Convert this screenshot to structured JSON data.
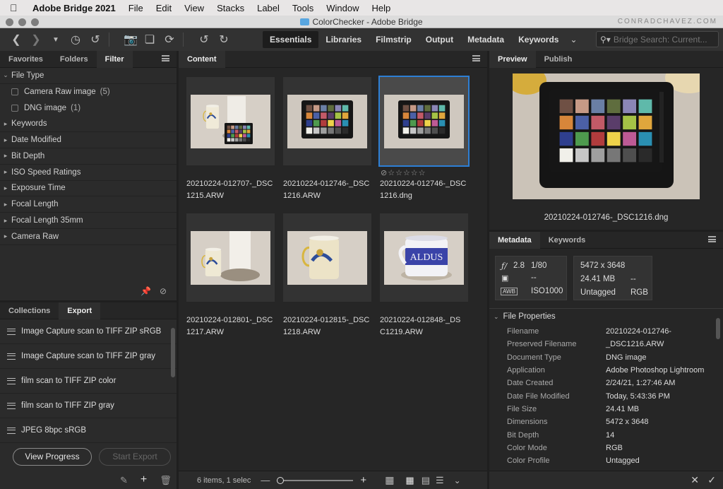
{
  "menubar": {
    "apple": "",
    "app": "Adobe Bridge 2021",
    "items": [
      "File",
      "Edit",
      "View",
      "Stacks",
      "Label",
      "Tools",
      "Window",
      "Help"
    ]
  },
  "window": {
    "title": "ColorChecker - Adobe Bridge",
    "credit": "CONRADCHAVEZ.COM"
  },
  "toolbar": {
    "workspaces": [
      "Essentials",
      "Libraries",
      "Filmstrip",
      "Output",
      "Metadata",
      "Keywords"
    ],
    "active_workspace": "Essentials",
    "search_placeholder": "Bridge Search: Current..."
  },
  "left_panel": {
    "tabs": [
      "Favorites",
      "Folders",
      "Filter"
    ],
    "active_tab": "Filter",
    "file_type_label": "File Type",
    "file_types": [
      {
        "label": "Camera Raw image",
        "count": "(5)"
      },
      {
        "label": "DNG image",
        "count": "(1)"
      }
    ],
    "filters": [
      "Keywords",
      "Date Modified",
      "Bit Depth",
      "ISO Speed Ratings",
      "Exposure Time",
      "Focal Length",
      "Focal Length 35mm",
      "Camera Raw"
    ]
  },
  "export_panel": {
    "tabs": [
      "Collections",
      "Export"
    ],
    "active_tab": "Export",
    "presets": [
      "Image Capture scan to TIFF ZIP sRGB",
      "Image Capture scan to TIFF ZIP gray",
      "film scan to TIFF ZIP color",
      "film scan to TIFF ZIP gray",
      "JPEG 8bpc sRGB"
    ],
    "view_progress": "View Progress",
    "start_export": "Start Export"
  },
  "content": {
    "tab": "Content",
    "items": [
      {
        "name": "20210224-012707-_DSC1215.ARW",
        "line1": "20210224-012707-_DSC",
        "line2": "1215.ARW",
        "kind": "mug-checker",
        "selected": false
      },
      {
        "name": "20210224-012746-_DSC1216.ARW",
        "line1": "20210224-012746-_DSC",
        "line2": "1216.ARW",
        "kind": "checker",
        "selected": false
      },
      {
        "name": "20210224-012746-_DSC1216.dng",
        "line1": "20210224-012746-_DSC",
        "line2": "1216.dng",
        "kind": "checker",
        "selected": true
      },
      {
        "name": "20210224-012801-_DSC1217.ARW",
        "line1": "20210224-012801-_DSC",
        "line2": "1217.ARW",
        "kind": "mug-roll",
        "selected": false
      },
      {
        "name": "20210224-012815-_DSC1218.ARW",
        "line1": "20210224-012815-_DSC",
        "line2": "1218.ARW",
        "kind": "mug",
        "selected": false
      },
      {
        "name": "20210224-012848-_DSC1219.ARW",
        "line1": "20210224-012848-_DS",
        "line2": "C1219.ARW",
        "kind": "aldus",
        "selected": false
      }
    ],
    "status": "6 items, 1 selec"
  },
  "preview": {
    "tabs": [
      "Preview",
      "Publish"
    ],
    "active_tab": "Preview",
    "filename": "20210224-012746-_DSC1216.dng"
  },
  "metadata": {
    "tabs": [
      "Metadata",
      "Keywords"
    ],
    "active_tab": "Metadata",
    "camera": {
      "aperture": "2.8",
      "shutter": "1/80",
      "metering": "--",
      "iso_label": "ISO",
      "iso": "1000",
      "wb": "AWB"
    },
    "image": {
      "dimensions": "5472 x 3648",
      "size": "24.41 MB",
      "dash": "--",
      "profile": "Untagged",
      "mode": "RGB"
    },
    "section": "File Properties",
    "props": [
      {
        "k": "Filename",
        "v": "20210224-012746-"
      },
      {
        "k": "Preserved Filename",
        "v": "_DSC1216.ARW"
      },
      {
        "k": "Document Type",
        "v": "DNG image"
      },
      {
        "k": "Application",
        "v": "Adobe Photoshop Lightroom"
      },
      {
        "k": "Date Created",
        "v": "2/24/21, 1:27:46 AM"
      },
      {
        "k": "Date File Modified",
        "v": "Today, 5:43:36 PM"
      },
      {
        "k": "File Size",
        "v": "24.41 MB"
      },
      {
        "k": "Dimensions",
        "v": "5472 x 3648"
      },
      {
        "k": "Bit Depth",
        "v": "14"
      },
      {
        "k": "Color Mode",
        "v": "RGB"
      },
      {
        "k": "Color Profile",
        "v": "Untagged"
      }
    ]
  },
  "colors": {
    "accent": "#2d7fd5",
    "panel": "#2b2b2b",
    "content": "#262626"
  }
}
